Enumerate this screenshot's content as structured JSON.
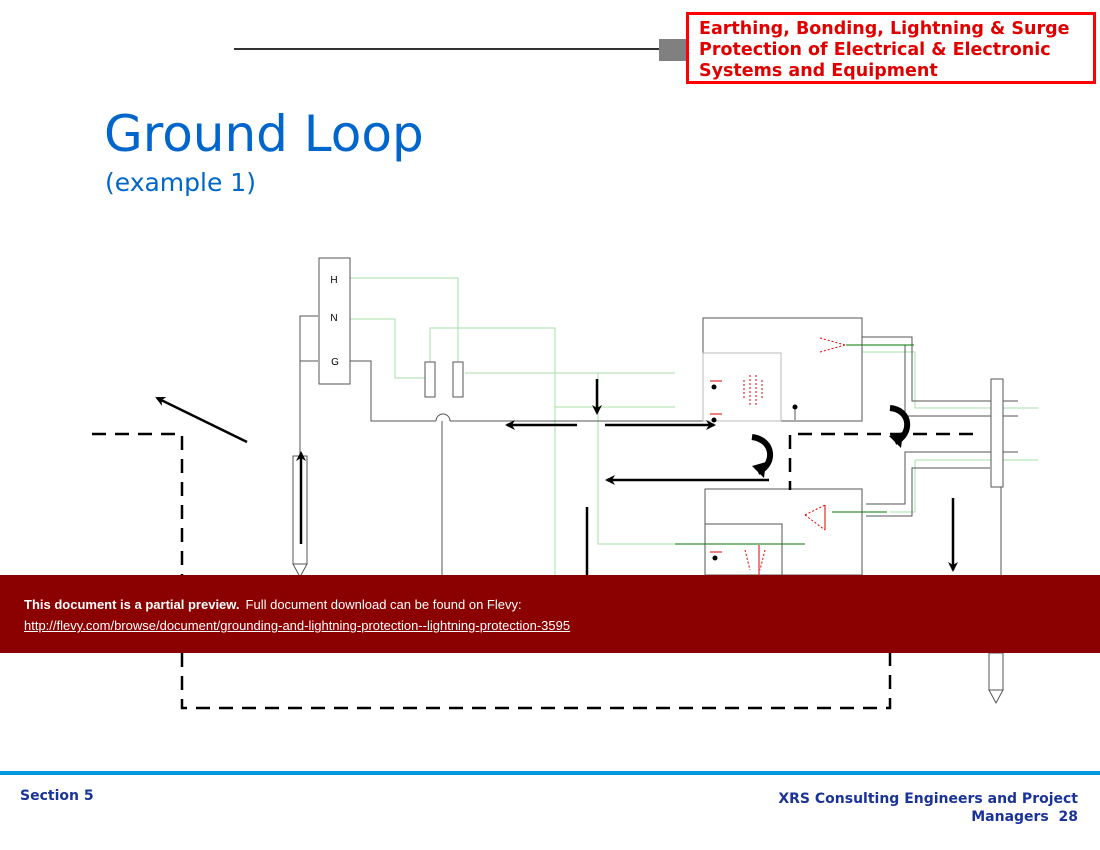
{
  "header": {
    "box_text": "Earthing, Bonding, Lightning & Surge Protection of Electrical & Electronic Systems and Equipment"
  },
  "slide": {
    "title": "Ground Loop",
    "subtitle": "(example 1)"
  },
  "diagram": {
    "panel_labels": [
      "H",
      "N",
      "G"
    ]
  },
  "banner": {
    "bold_text": "This document is a partial preview.",
    "text": "Full document download can be found on Flevy:",
    "link": "http://flevy.com/browse/document/grounding-and-lightning-protection--lightning-protection-3595"
  },
  "footer": {
    "section": "Section 5",
    "company": "XRS Consulting Engineers and Project Managers",
    "page": "28"
  },
  "colors": {
    "title": "#0066cc",
    "header_red": "#e00000",
    "banner": "#8b0000",
    "footer_line": "#0099dd",
    "footer_text": "#1a3399"
  }
}
